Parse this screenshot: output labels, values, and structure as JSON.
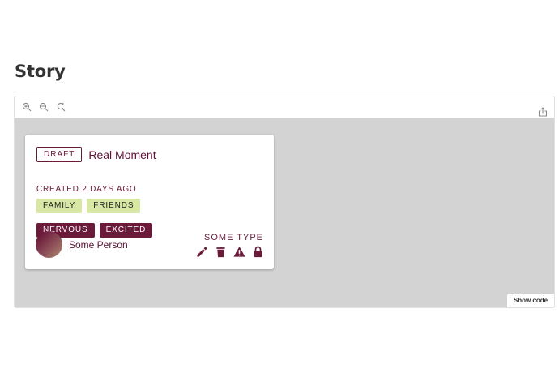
{
  "page": {
    "title": "Story"
  },
  "toolbar": {
    "icons": [
      "zoom-in-icon",
      "zoom-out-icon",
      "reset-zoom-icon",
      "share-icon"
    ]
  },
  "card": {
    "status_badge": "DRAFT",
    "title": "Real Moment",
    "created": "CREATED 2 DAYS AGO",
    "interests": [
      "FAMILY",
      "FRIENDS"
    ],
    "feelings": [
      "NERVOUS",
      "EXCITED"
    ],
    "person_name": "Some Person",
    "type": "SOME TYPE",
    "actions": [
      "edit-icon",
      "delete-icon",
      "warning-icon",
      "lock-icon"
    ]
  },
  "footer": {
    "show_code_label": "Show code"
  },
  "colors": {
    "brand": "#6b1a3a",
    "tag_light": "#d8e7a3",
    "canvas_bg": "#d3d3d3"
  }
}
